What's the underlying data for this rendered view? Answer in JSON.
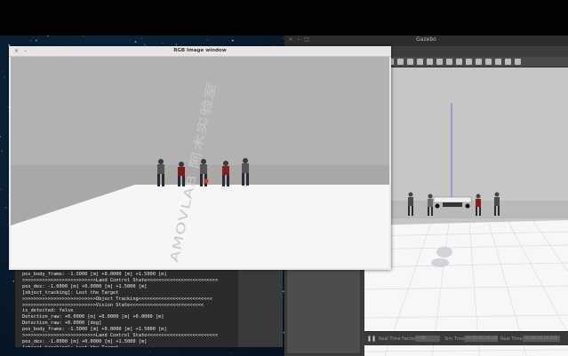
{
  "colors": {
    "sky": "#b2b2b0",
    "ground": "#a8a8a6",
    "floor": "#f6f6f6",
    "terminal_bg": "#2b2b2b",
    "terminal_text": "#e8e8e8"
  },
  "rgb_window": {
    "title": "RGB Image window",
    "close_glyph": "×",
    "minimize_glyph": "–",
    "floor_logo": "AMOVLAB 阿木实验室"
  },
  "gazebo_window": {
    "title": "Gazebo",
    "close_glyph": "×",
    "minimize_glyph": "–",
    "maximize_glyph": "□",
    "toolbar_icons": [
      "undo-icon",
      "redo-icon",
      "box-icon",
      "sphere-icon",
      "cylinder-icon",
      "sun-icon",
      "spotlight-icon",
      "dirlight-icon",
      "copy-icon",
      "paste-icon",
      "align-icon",
      "snap-icon",
      "screenshot-icon",
      "camera-icon"
    ],
    "statusbar": {
      "pause_glyph": "❚❚",
      "real_time_factor_label": "Real Time Factor:",
      "real_time_factor_value": "0.99",
      "sim_time_label": "Sim Time:",
      "sim_time_value": "00 00:00:26.248",
      "real_time_label": "Real Time:",
      "real_time_value": "00 00:00:26.500"
    }
  },
  "terminal": {
    "lines": [
      "pos_body_frame: -1.5000 [m] +0.0000 [m] +1.5000 [m]",
      ">>>>>>>>>>>>>>>>>>>>>>>>>>Land Control State<<<<<<<<<<<<<<<<<<<<<<<<<",
      "pos_des: -1.0000 [m] +0.0000 [m] +1.5000 [m]",
      "[object_tracking]: Lost the Target",
      ">>>>>>>>>>>>>>>>>>>>>>>>>>Object Tracking<<<<<<<<<<<<<<<<<<<<<<<<<<",
      ">>>>>>>>>>>>>>>>>>>>>>>>>>Vision State<<<<<<<<<<<<<<<<<<<<<<<<<<",
      "is_detected: false",
      "Detection_raw: +0.0000 [m] +0.0000 [m] +0.0000 [m]",
      "Detection_raw: +0.0000 [deg]",
      "pos_body_frame: -1.5000 [m] +0.0000 [m] +1.5000 [m]",
      ">>>>>>>>>>>>>>>>>>>>>>>>>>Land Control State<<<<<<<<<<<<<<<<<<<<<<<<<",
      "pos_des: -1.0000 [m] +0.0000 [m] +1.5000 [m]",
      "[object_tracking]: Lost the Target",
      "[]"
    ]
  }
}
